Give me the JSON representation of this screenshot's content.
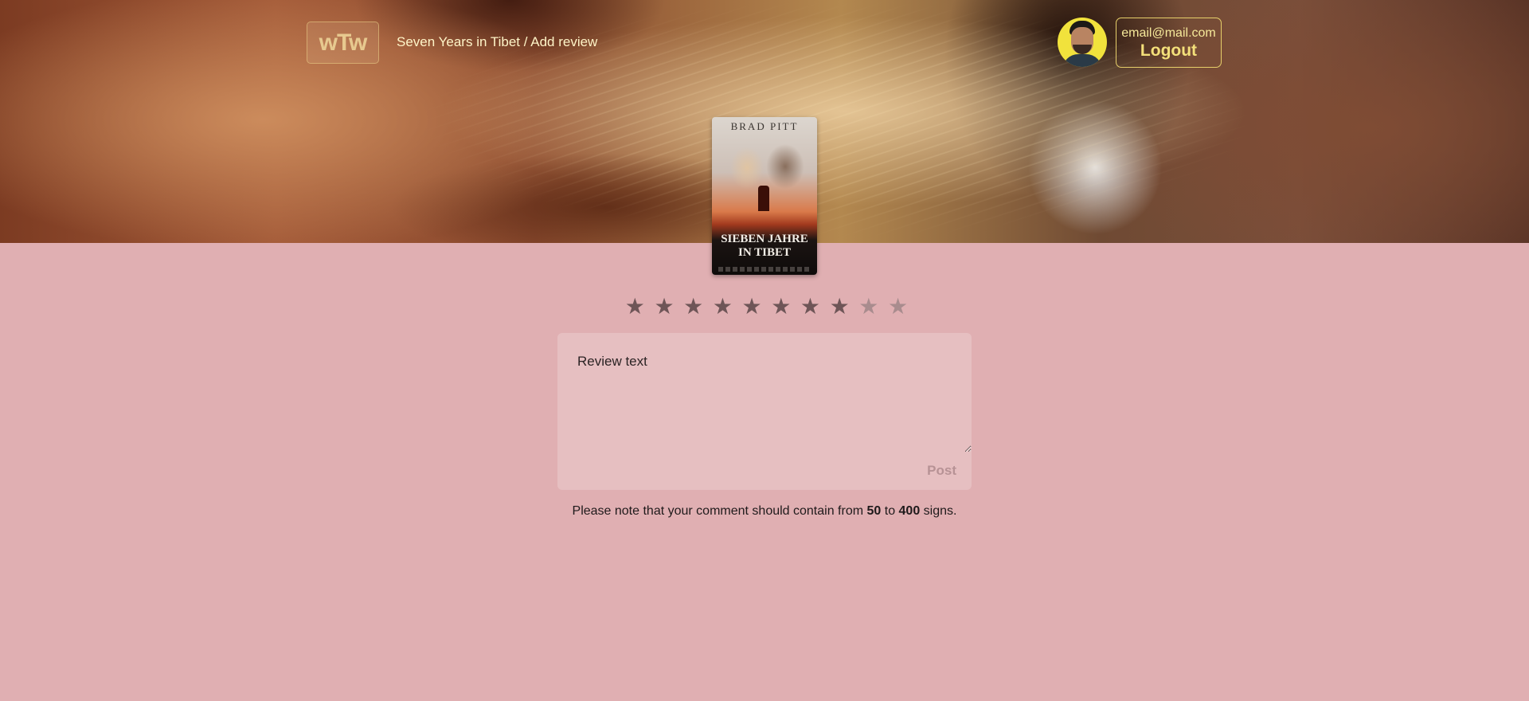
{
  "header": {
    "logo_text": "wTw",
    "breadcrumb": "Seven Years in Tibet / Add review",
    "user_email": "email@mail.com",
    "logout_label": "Logout"
  },
  "poster": {
    "actor": "BRAD PITT",
    "title_line1": "SIEBEN JAHRE",
    "title_line2": "IN TIBET"
  },
  "rating": {
    "value": 8,
    "max": 10,
    "icon": "star-icon"
  },
  "review": {
    "placeholder": "Review text",
    "value": "",
    "post_label": "Post"
  },
  "note": {
    "prefix": "Please note that your comment should contain from ",
    "min": "50",
    "middle": " to ",
    "max": "400",
    "suffix": " signs."
  },
  "colors": {
    "background": "#e0afb2",
    "accent": "#f4e07a",
    "star_filled": "#6e5557",
    "star_empty": "#a98c8e"
  }
}
